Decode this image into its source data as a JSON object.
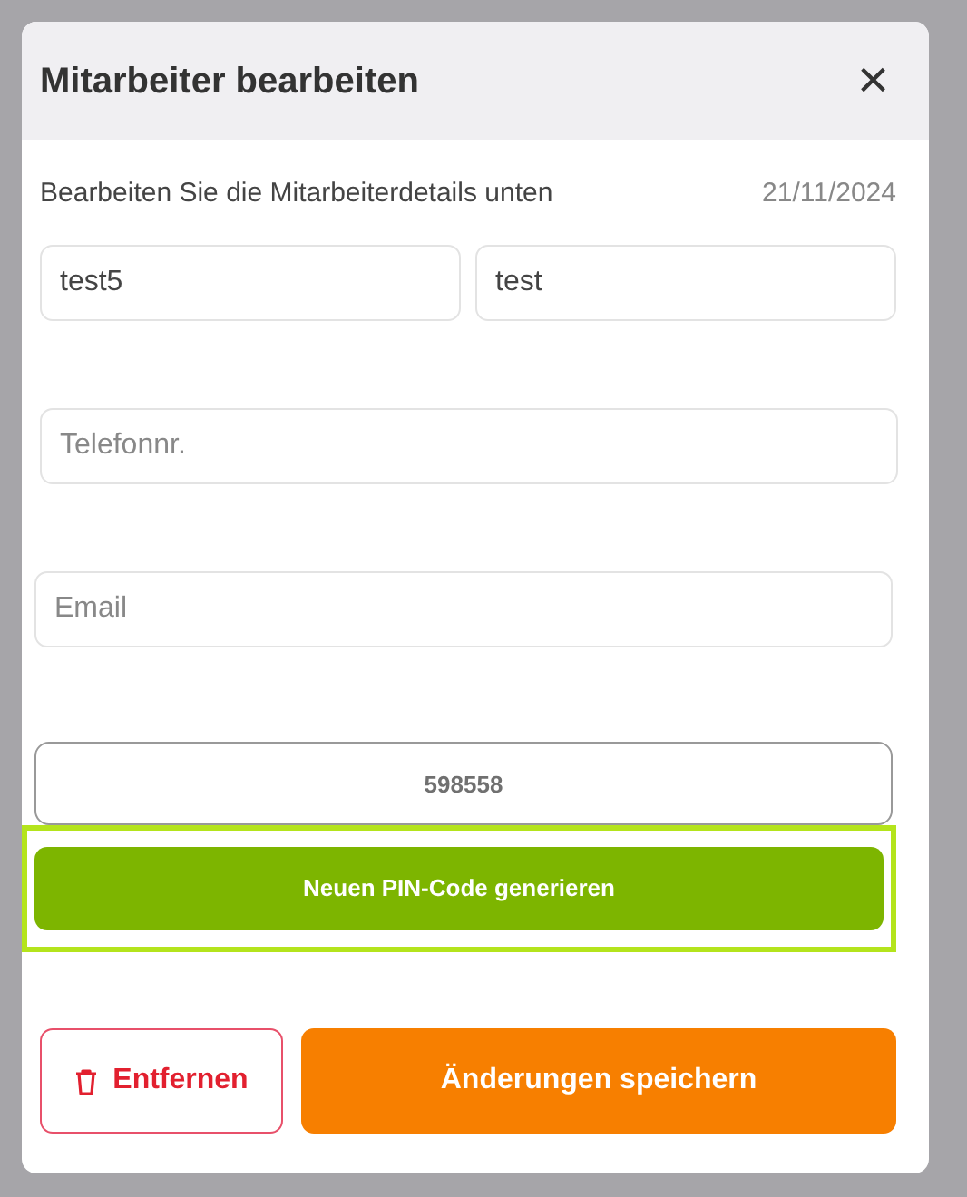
{
  "dialog": {
    "title": "Mitarbeiter bearbeiten",
    "close_label": "×",
    "subtitle": "Bearbeiten Sie die Mitarbeiterdetails unten",
    "date": "21/11/2024"
  },
  "name_fields": [
    {
      "value": "test5"
    },
    {
      "value": "test"
    }
  ],
  "fields": [
    {
      "placeholder": "Telefonnr."
    },
    {
      "placeholder": "Email"
    }
  ],
  "pin_field": {
    "value": "598558"
  },
  "generate_button": {
    "label": "Neuen PIN-Code generieren",
    "highlighted": true
  },
  "remove_button": {
    "label": "Entfernen"
  },
  "save_button": {
    "label": "Änderungen speichern"
  }
}
